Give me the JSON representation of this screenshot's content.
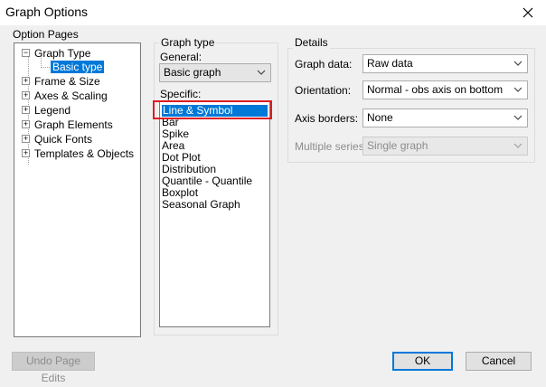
{
  "window": {
    "title": "Graph Options"
  },
  "option_pages": {
    "label": "Option Pages",
    "items": [
      {
        "label": "Graph Type",
        "expander": "−"
      },
      {
        "label": "Basic type"
      },
      {
        "label": "Frame & Size",
        "expander": "+"
      },
      {
        "label": "Axes & Scaling",
        "expander": "+"
      },
      {
        "label": "Legend",
        "expander": "+"
      },
      {
        "label": "Graph Elements",
        "expander": "+"
      },
      {
        "label": "Quick Fonts",
        "expander": "+"
      },
      {
        "label": "Templates & Objects",
        "expander": "+"
      }
    ]
  },
  "graph_type": {
    "label": "Graph type",
    "general_label": "General:",
    "general_value": "Basic graph",
    "specific_label": "Specific:",
    "specific_items": [
      "Line & Symbol",
      "Bar",
      "Spike",
      "Area",
      "Dot Plot",
      "Distribution",
      "Quantile - Quantile",
      "Boxplot",
      "Seasonal Graph"
    ]
  },
  "details": {
    "label": "Details",
    "rows": [
      {
        "label": "Graph data:",
        "value": "Raw data"
      },
      {
        "label": "Orientation:",
        "value": "Normal - obs axis on bottom"
      },
      {
        "label": "Axis borders:",
        "value": "None"
      },
      {
        "label": "Multiple series:",
        "value": "Single graph"
      }
    ]
  },
  "buttons": {
    "undo": "Undo Page Edits",
    "ok": "OK",
    "cancel": "Cancel"
  },
  "colors": {
    "selection": "#0078d7",
    "highlight_box": "#e01a22",
    "background": "#f0f0f0"
  }
}
